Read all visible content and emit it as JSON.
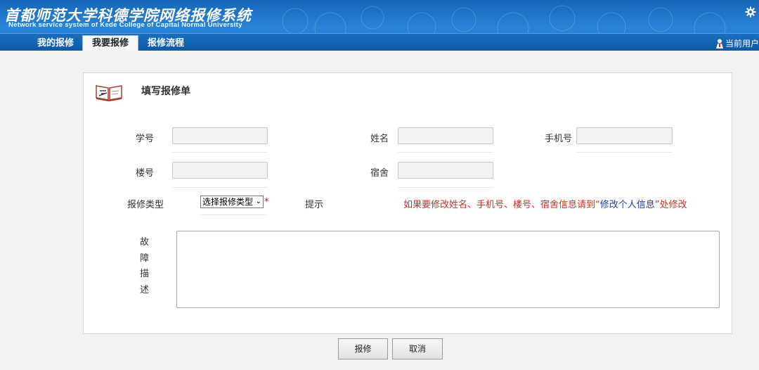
{
  "header": {
    "logo_cn": "首都师范大学科德学院网络报修系统",
    "logo_en": "Network service system of Kede College of Capital Normal University",
    "user_label": "当前用户"
  },
  "nav": {
    "tabs": [
      {
        "label": "我的报修",
        "active": false
      },
      {
        "label": "我要报修",
        "active": true
      },
      {
        "label": "报修流程",
        "active": false
      }
    ]
  },
  "form": {
    "title": "填写报修单",
    "fields": {
      "student_id": {
        "label": "学号",
        "value": ""
      },
      "name": {
        "label": "姓名",
        "value": ""
      },
      "phone": {
        "label": "手机号",
        "value": ""
      },
      "building": {
        "label": "楼号",
        "value": ""
      },
      "dorm": {
        "label": "宿舍",
        "value": ""
      }
    },
    "repair_type": {
      "label": "报修类型",
      "selected": "选择报修类型",
      "required_mark": "*"
    },
    "hint": {
      "label": "提示",
      "text_before": "如果要修改姓名、手机号、楼号、宿舍信息请到“",
      "link_text": "修改个人信息",
      "text_after": "”处修改"
    },
    "description": {
      "label": "故障描述",
      "value": ""
    }
  },
  "buttons": {
    "submit": "报修",
    "cancel": "取消"
  },
  "colors": {
    "header_blue": "#1b6fc3",
    "hint_red": "#c9302c",
    "hint_link": "#2a3a9a"
  }
}
